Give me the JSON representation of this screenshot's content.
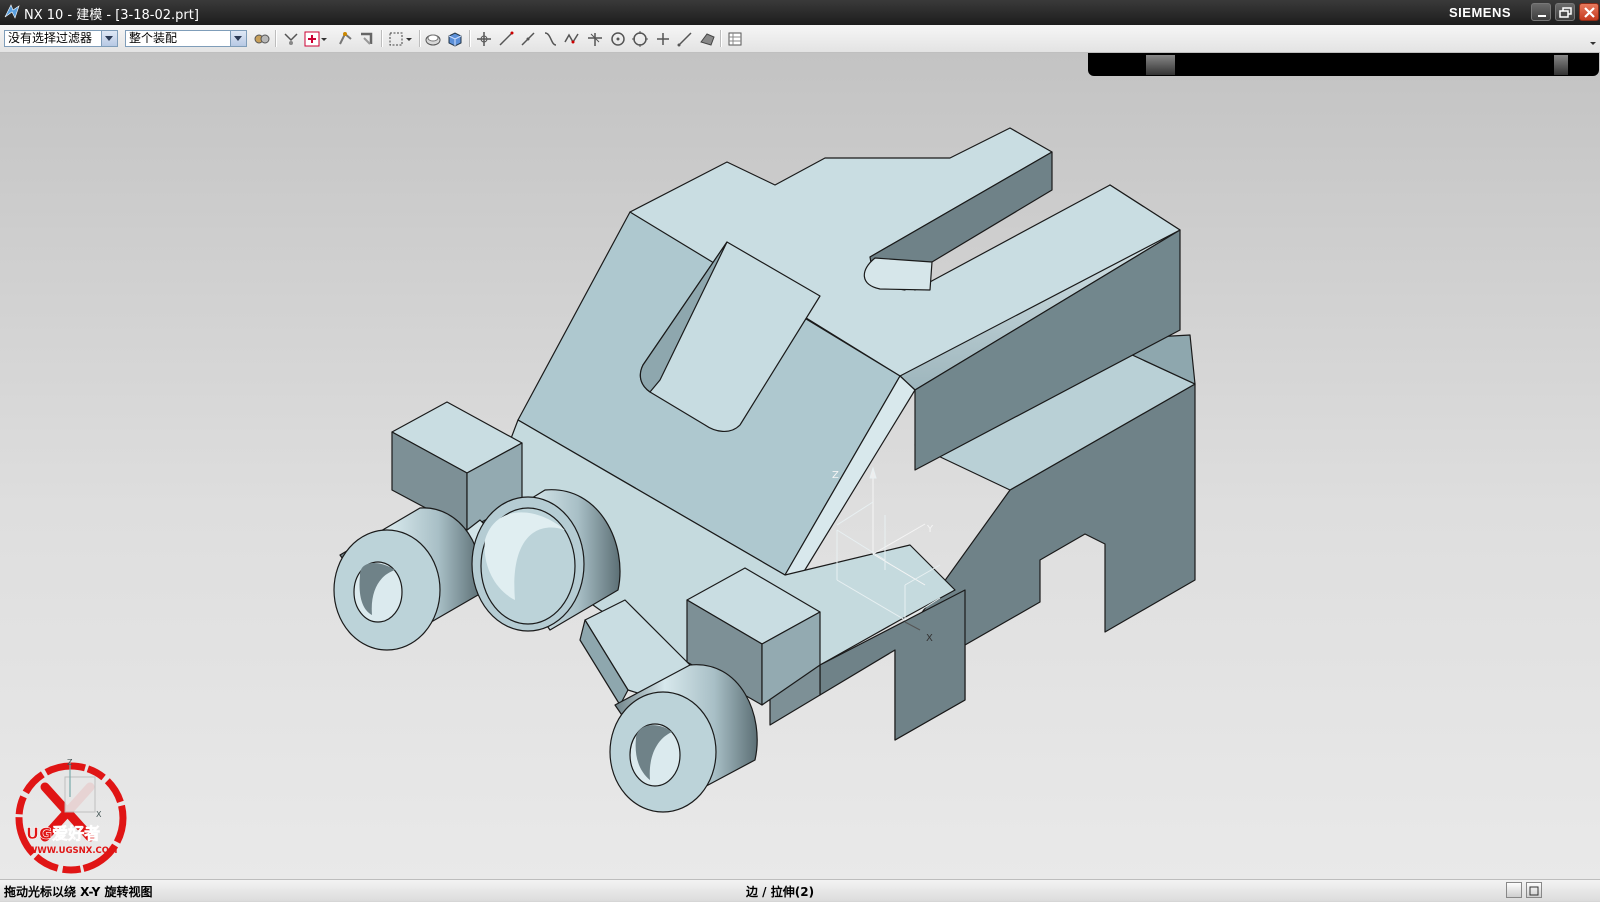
{
  "window": {
    "title": "NX 10 - 建模 - [3-18-02.prt]",
    "brand": "SIEMENS"
  },
  "toolbar": {
    "selection_filter": "没有选择过滤器",
    "scope": "整个装配",
    "icons": [
      "filter-settings-icon",
      "snap-point-icon",
      "select-type-icon",
      "select-chain-icon",
      "select-feature-icon",
      "rectangle-select-icon",
      "shaded-view-icon",
      "view-cube-icon",
      "move-icon",
      "line-icon",
      "line-icon-2",
      "curve-icon",
      "spline-icon",
      "intersection-icon",
      "point-circle-icon",
      "circle-icon",
      "plus-icon",
      "slash-line-icon",
      "wcs-icon",
      "table-icon"
    ]
  },
  "viewport": {
    "triad_labels": {
      "x": "X",
      "y": "Y",
      "z": "Z"
    },
    "wcs_labels": {
      "x": "X",
      "y": "Y",
      "z": "Z"
    }
  },
  "watermark": {
    "text": "UG爱好者",
    "url": "WWW.UGSNX.COM"
  },
  "status": {
    "left": "拖动光标以绕 X-Y 旋转视图",
    "middle": "边 / 拉伸(2)"
  },
  "colors": {
    "model_light": "#c9dde2",
    "model_mid": "#aac5cd",
    "model_dark": "#6f8288",
    "edge": "#1a1a1a"
  }
}
